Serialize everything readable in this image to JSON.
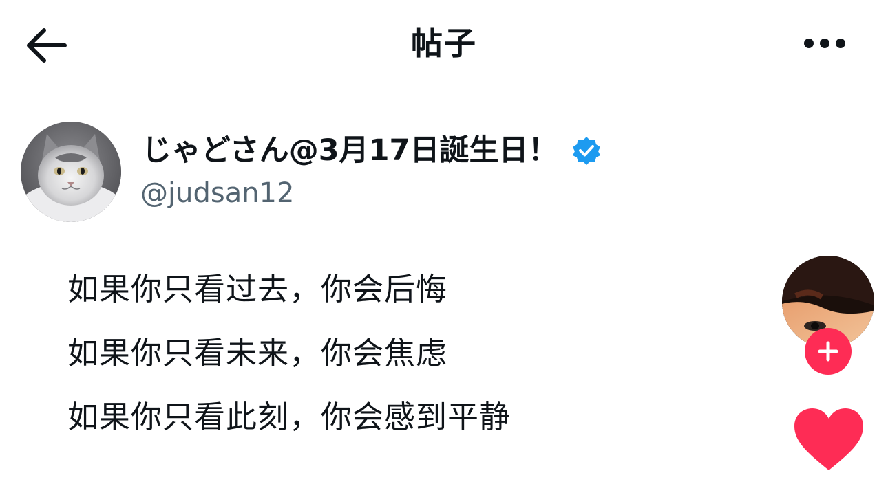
{
  "header": {
    "back_icon": "arrow-left-icon",
    "title": "帖子",
    "more_icon": "more-horizontal-icon"
  },
  "post": {
    "author": {
      "display_name": "じゃどさん@3月17日誕生日！",
      "handle": "@judsan12",
      "verified": true,
      "verified_icon": "verified-badge-icon",
      "avatar": "cat-avatar"
    },
    "lines": [
      "如果你只看过去，你会后悔",
      "如果你只看未来，你会焦虑",
      "如果你只看此刻，你会感到平静"
    ]
  },
  "side_actions": {
    "creator_avatar": "creator-avatar",
    "follow_icon": "plus-icon",
    "like_icon": "heart-icon",
    "like_count": ""
  },
  "colors": {
    "text": "#0f1419",
    "secondary_text": "#536471",
    "verified": "#1d9bf0",
    "accent": "#fe2c55"
  }
}
